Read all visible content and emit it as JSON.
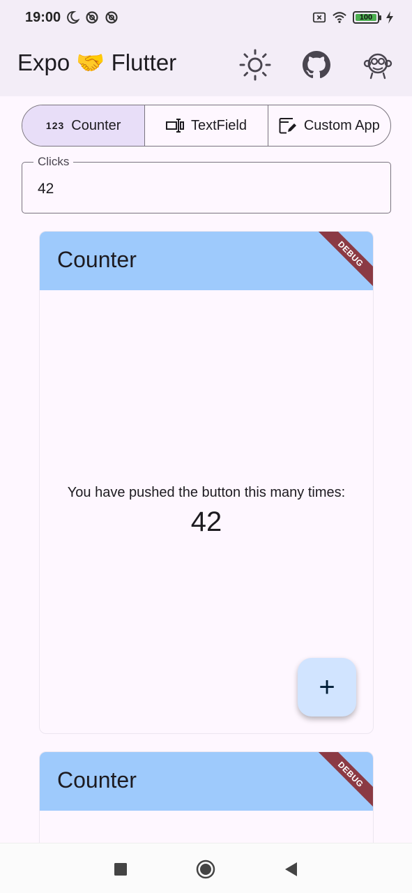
{
  "status_bar": {
    "time": "19:00",
    "battery": "100"
  },
  "app_bar": {
    "title": "Expo 🤝 Flutter",
    "icons": [
      "theme-toggle-icon",
      "github-icon",
      "dash-monkey-icon"
    ]
  },
  "segmented_control": {
    "segments": [
      {
        "icon_text": "123",
        "label": "Counter",
        "selected": true
      },
      {
        "label": "TextField",
        "selected": false
      },
      {
        "label": "Custom App",
        "selected": false
      }
    ]
  },
  "clicks_field": {
    "label": "Clicks",
    "value": "42"
  },
  "cards": [
    {
      "title": "Counter",
      "debug_banner": "DEBUG",
      "message": "You have pushed the button this many times:",
      "count": "42",
      "fab_label": "+"
    },
    {
      "title": "Counter",
      "debug_banner": "DEBUG"
    }
  ],
  "colors": {
    "app_bar_bg": "#f3edf7",
    "card_header": "#9ecafc",
    "segment_selected": "#e8def8",
    "fab_bg": "#d1e4ff",
    "debug_banner": "#8b3a44"
  },
  "navigation_bar": {
    "buttons": [
      "recents-square-icon",
      "home-circle-icon",
      "back-triangle-icon"
    ]
  }
}
